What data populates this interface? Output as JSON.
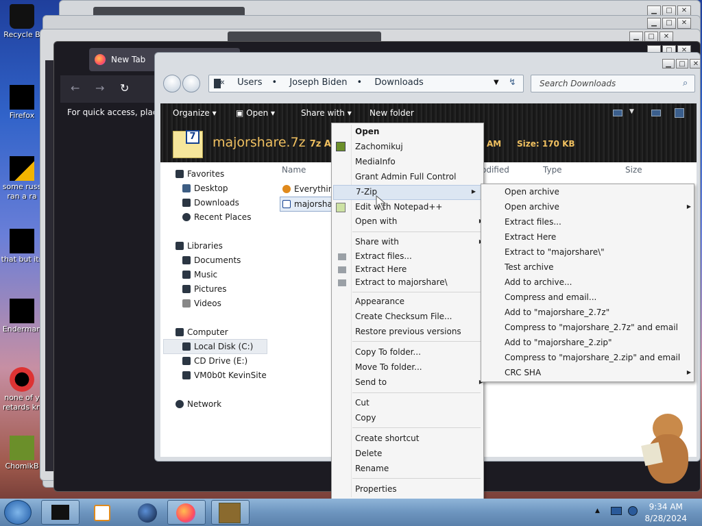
{
  "desktop": {
    "icons": [
      {
        "label": "Recycle B"
      },
      {
        "label": "Firefox"
      },
      {
        "label": "some russ ran a ra"
      },
      {
        "label": "that but its"
      },
      {
        "label": "Enderman"
      },
      {
        "label": "none of y retards kn"
      },
      {
        "label": "ChomikB"
      }
    ]
  },
  "browser": {
    "tab_title": "New Tab",
    "quick_access_text": "For quick access, place y"
  },
  "explorer": {
    "breadcrumb": [
      "Users",
      "Joseph Biden",
      "Downloads"
    ],
    "breadcrumb_prefix": "«",
    "search_placeholder": "Search Downloads",
    "toolbar": {
      "organize": "Organize",
      "open": "Open",
      "share_with": "Share with",
      "new_folder": "New folder"
    },
    "details": {
      "file_name": "majorshare.7z",
      "file_type": "7z Ar",
      "time_suffix": "AM",
      "size": "Size: 170 KB"
    },
    "nav": {
      "favorites": "Favorites",
      "desktop": "Desktop",
      "downloads": "Downloads",
      "recent_places": "Recent Places",
      "libraries": "Libraries",
      "documents": "Documents",
      "music": "Music",
      "pictures": "Pictures",
      "videos": "Videos",
      "computer": "Computer",
      "local_disk": "Local Disk (C:)",
      "cd_drive": "CD Drive (E:)",
      "vm_share": "VM0b0t KevinSite",
      "network": "Network"
    },
    "columns": {
      "name": "Name",
      "modified": "odified",
      "type": "Type",
      "size": "Size"
    },
    "files": [
      {
        "name": "Everything"
      },
      {
        "name": "majorshar"
      }
    ]
  },
  "context_menu": {
    "items": [
      {
        "label": "Open",
        "bold": true
      },
      {
        "label": "Zachomikuj"
      },
      {
        "label": "MediaInfo"
      },
      {
        "label": "Grant Admin Full Control"
      },
      {
        "label": "7-Zip",
        "submenu": true,
        "highlighted": true
      },
      {
        "label": "Edit with Notepad++"
      },
      {
        "label": "Open with",
        "submenu": true
      },
      {
        "label": "Share with",
        "submenu": true
      },
      {
        "label": "Extract files..."
      },
      {
        "label": "Extract Here"
      },
      {
        "label": "Extract to majorshare\\"
      },
      {
        "label": "Appearance"
      },
      {
        "label": "Create Checksum File..."
      },
      {
        "label": "Restore previous versions"
      },
      {
        "label": "Copy To folder..."
      },
      {
        "label": "Move To folder..."
      },
      {
        "label": "Send to",
        "submenu": true
      },
      {
        "label": "Cut"
      },
      {
        "label": "Copy"
      },
      {
        "label": "Create shortcut"
      },
      {
        "label": "Delete"
      },
      {
        "label": "Rename"
      },
      {
        "label": "Properties"
      }
    ]
  },
  "sevenzip_menu": {
    "items": [
      {
        "label": "Open archive"
      },
      {
        "label": "Open archive",
        "submenu": true
      },
      {
        "label": "Extract files..."
      },
      {
        "label": "Extract Here"
      },
      {
        "label": "Extract to \"majorshare\\\""
      },
      {
        "label": "Test archive"
      },
      {
        "label": "Add to archive..."
      },
      {
        "label": "Compress and email..."
      },
      {
        "label": "Add to \"majorshare_2.7z\""
      },
      {
        "label": "Compress to \"majorshare_2.7z\" and email"
      },
      {
        "label": "Add to \"majorshare_2.zip\""
      },
      {
        "label": "Compress to \"majorshare_2.zip\" and email"
      },
      {
        "label": "CRC SHA",
        "submenu": true
      }
    ]
  },
  "taskbar": {
    "time": "9:34 AM",
    "date": "8/28/2024"
  }
}
